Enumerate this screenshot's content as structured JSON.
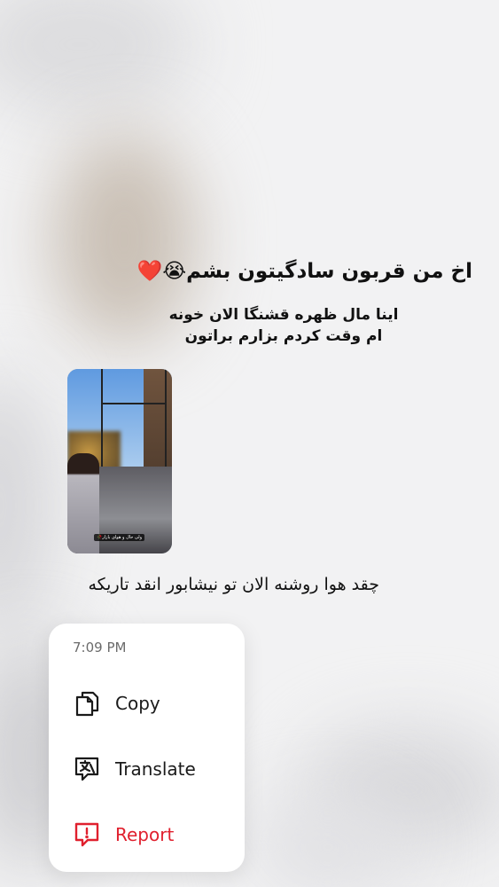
{
  "story": {
    "line1": "اخ من قربون سادگیتون بشم",
    "line1_emoji": "😭",
    "line1_heart": "❤️",
    "line2a": "اینا مال ظهره قشنگا الان خونه",
    "line2b": "ام وقت کردم بزارم براتون"
  },
  "thumbnail": {
    "caption": "ولی حال و هوای بازار🥀"
  },
  "reply": {
    "text": "چقد هوا روشنه الان تو نیشابور انقد تاریکه"
  },
  "menu": {
    "time": "7:09 PM",
    "items": [
      {
        "label": "Copy",
        "icon": "copy-icon"
      },
      {
        "label": "Translate",
        "icon": "translate-icon"
      },
      {
        "label": "Report",
        "icon": "report-icon",
        "color": "#e0202e"
      }
    ]
  }
}
